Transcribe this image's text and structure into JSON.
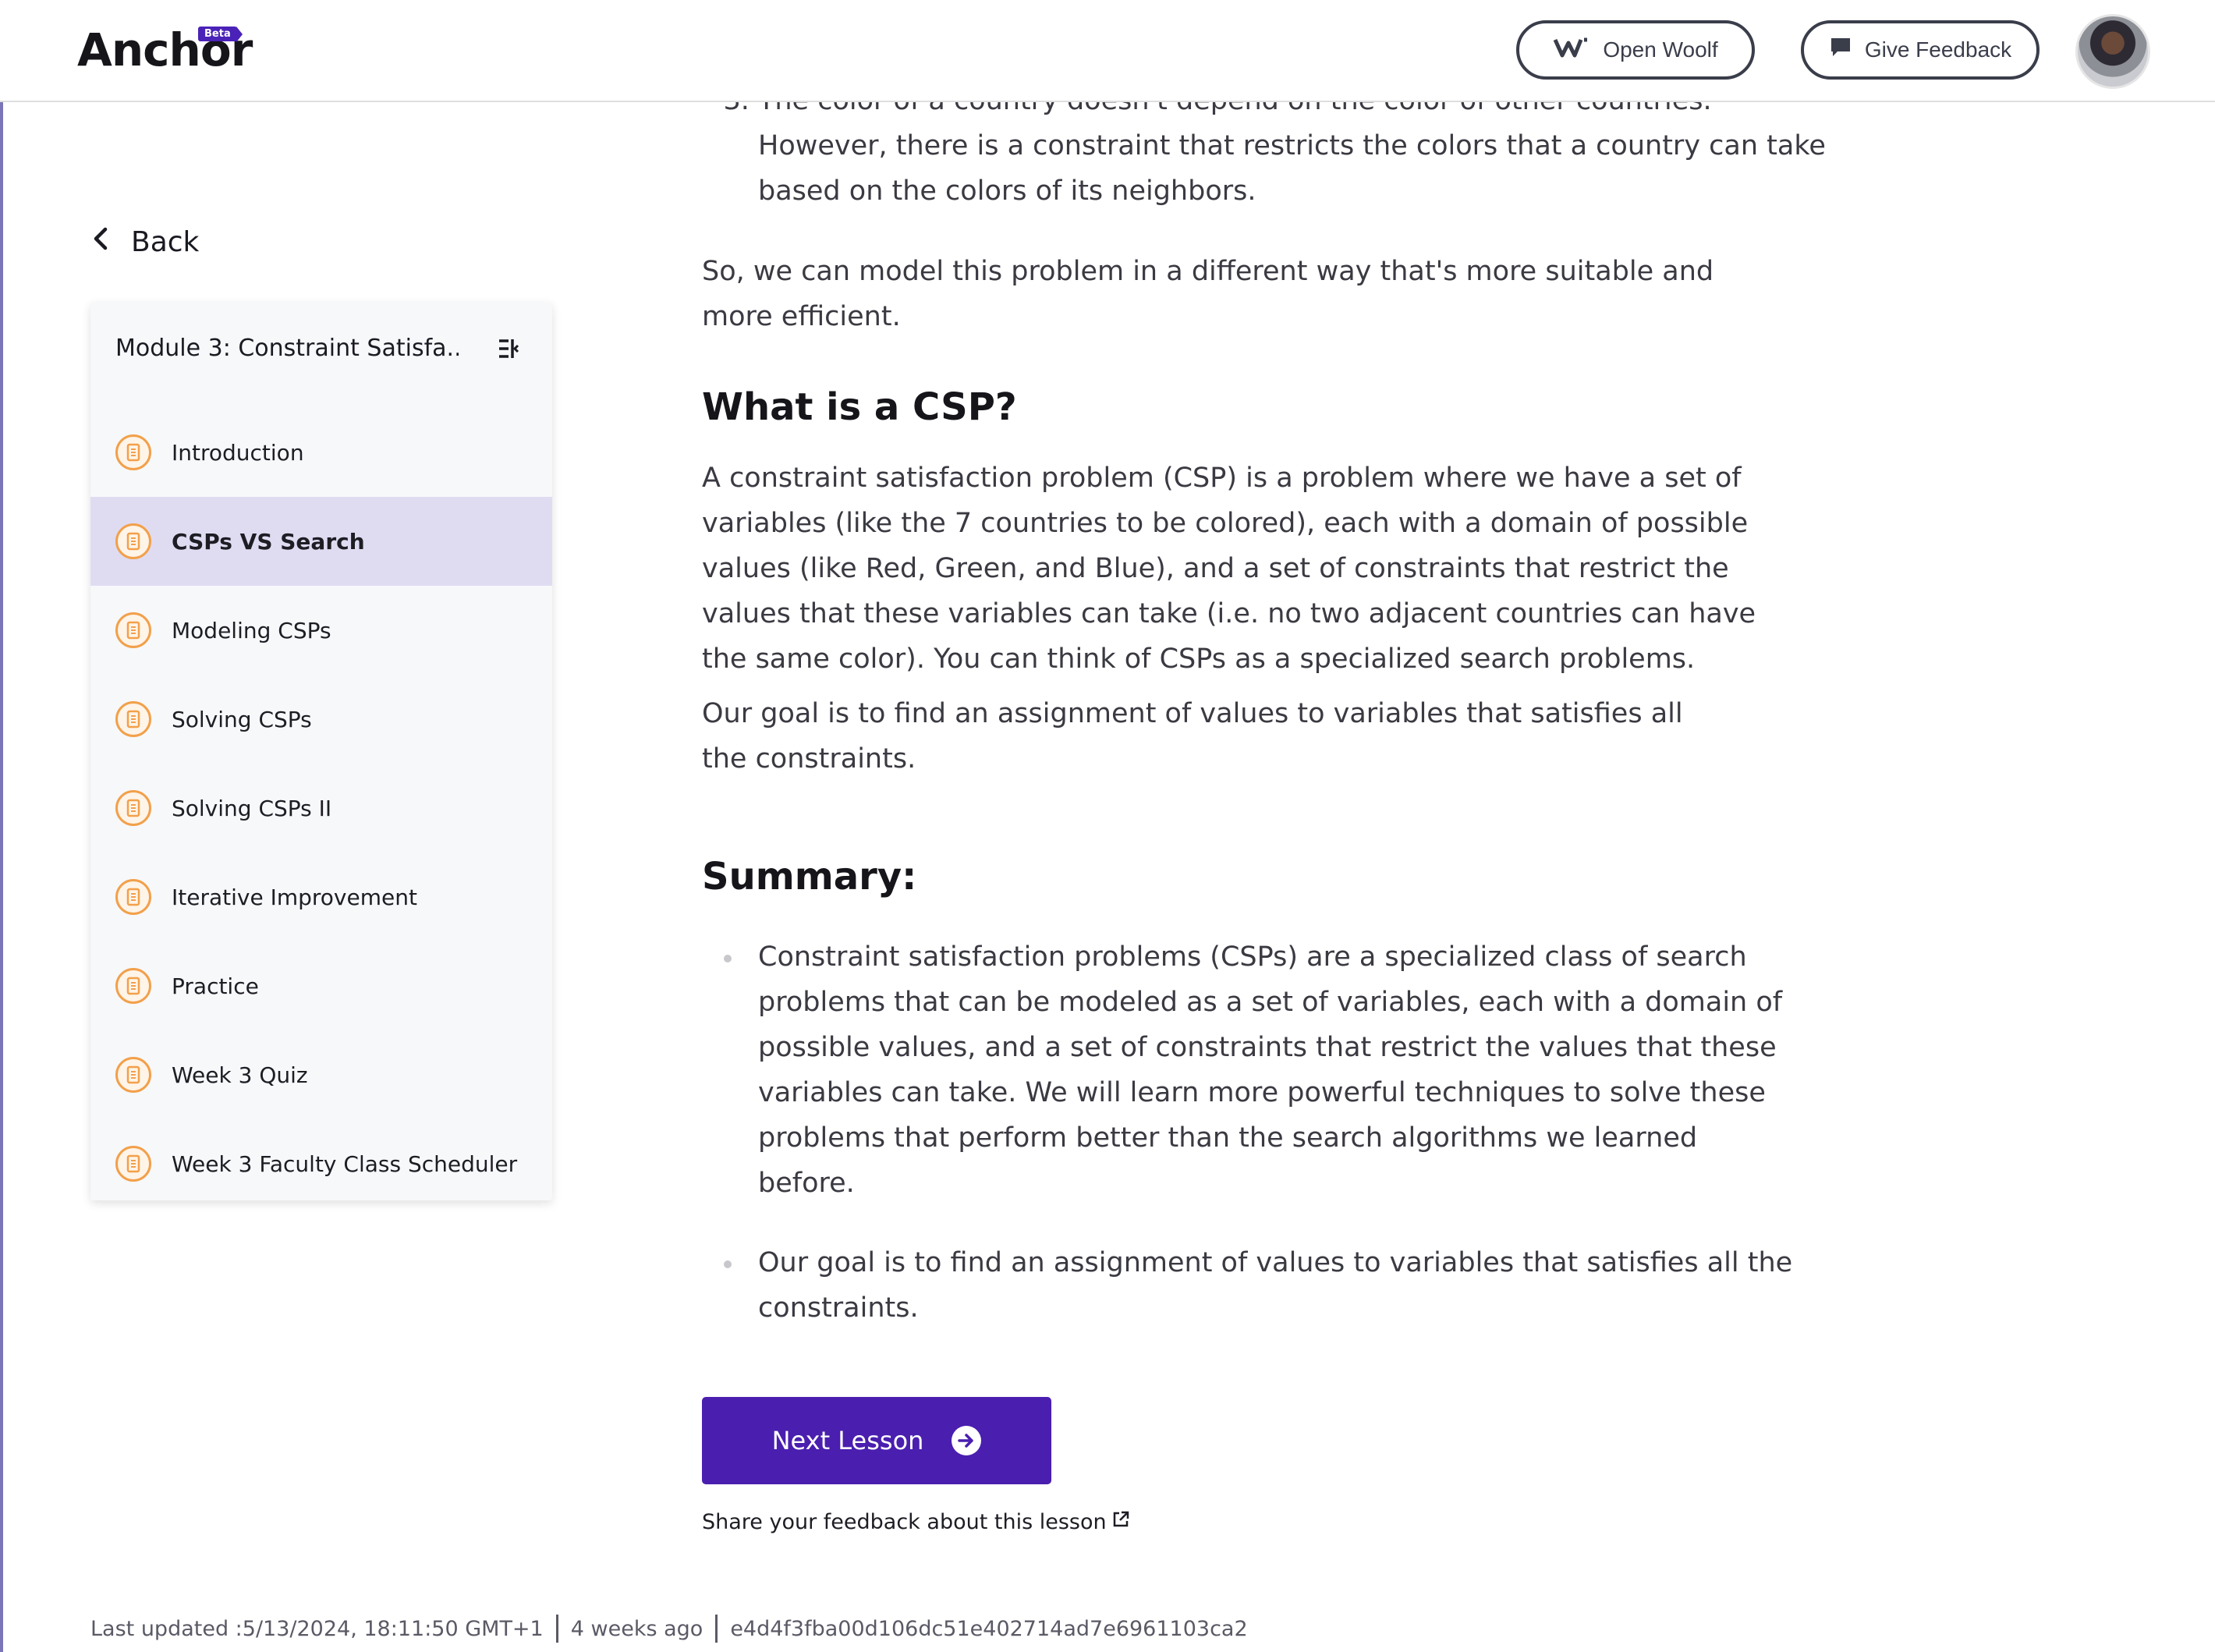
{
  "header": {
    "brand": "Anchor",
    "badge": "Beta",
    "open_woolf_label": "Open Woolf",
    "give_feedback_label": "Give Feedback"
  },
  "sidebar": {
    "back_label": "Back",
    "module_title": "Module 3: Constraint Satisfa...",
    "items": [
      {
        "label": "Introduction",
        "active": false
      },
      {
        "label": "CSPs VS Search",
        "active": true
      },
      {
        "label": "Modeling CSPs",
        "active": false
      },
      {
        "label": "Solving CSPs",
        "active": false
      },
      {
        "label": "Solving CSPs II",
        "active": false
      },
      {
        "label": "Iterative Improvement",
        "active": false
      },
      {
        "label": "Practice",
        "active": false
      },
      {
        "label": "Week 3 Quiz",
        "active": false
      },
      {
        "label": "Week 3 Faculty Class Scheduler",
        "active": false
      }
    ]
  },
  "content": {
    "list_item_3": "The color of a country doesn't depend on the color of other countries. However, there is a constraint that restricts the colors that a country can take based on the colors of its neighbors.",
    "paragraph_1": "So, we can model this problem in a different way that's more suitable and more efficient.",
    "heading_csp": "What is a CSP?",
    "paragraph_2": "A constraint satisfaction problem (CSP) is a problem where we have a set of variables (like the 7 countries to be colored), each with a domain of possible values (like Red, Green, and Blue), and a set of constraints that restrict the values that these variables can take (i.e. no two adjacent countries can have the same color). You can think of CSPs as a specialized search problems.",
    "paragraph_3": "Our goal is to find an assignment of values to variables that satisfies all the constraints.",
    "heading_summary": "Summary:",
    "summary_items": [
      "Constraint satisfaction problems (CSPs) are a specialized class of search problems that can be modeled as a set of variables, each with a domain of possible values, and a set of constraints that restrict the values that these variables can take. We will learn more powerful techniques to solve these problems that perform better than the search algorithms we learned before.",
      "Our goal is to find an assignment of values to variables that satisfies all the constraints."
    ]
  },
  "actions": {
    "next_lesson_label": "Next Lesson",
    "share_feedback_label": "Share your feedback about this lesson"
  },
  "footer": {
    "last_updated": "Last updated :5/13/2024, 18:11:50 GMT+1",
    "relative_time": "4 weeks ago",
    "commit_hash": "e4d4f3fba00d106dc51e402714ad7e6961103ca2"
  },
  "colors": {
    "accent": "#4a1eaf",
    "active_nav_bg": "#dfdcf2",
    "lesson_icon": "#f2a04a"
  }
}
